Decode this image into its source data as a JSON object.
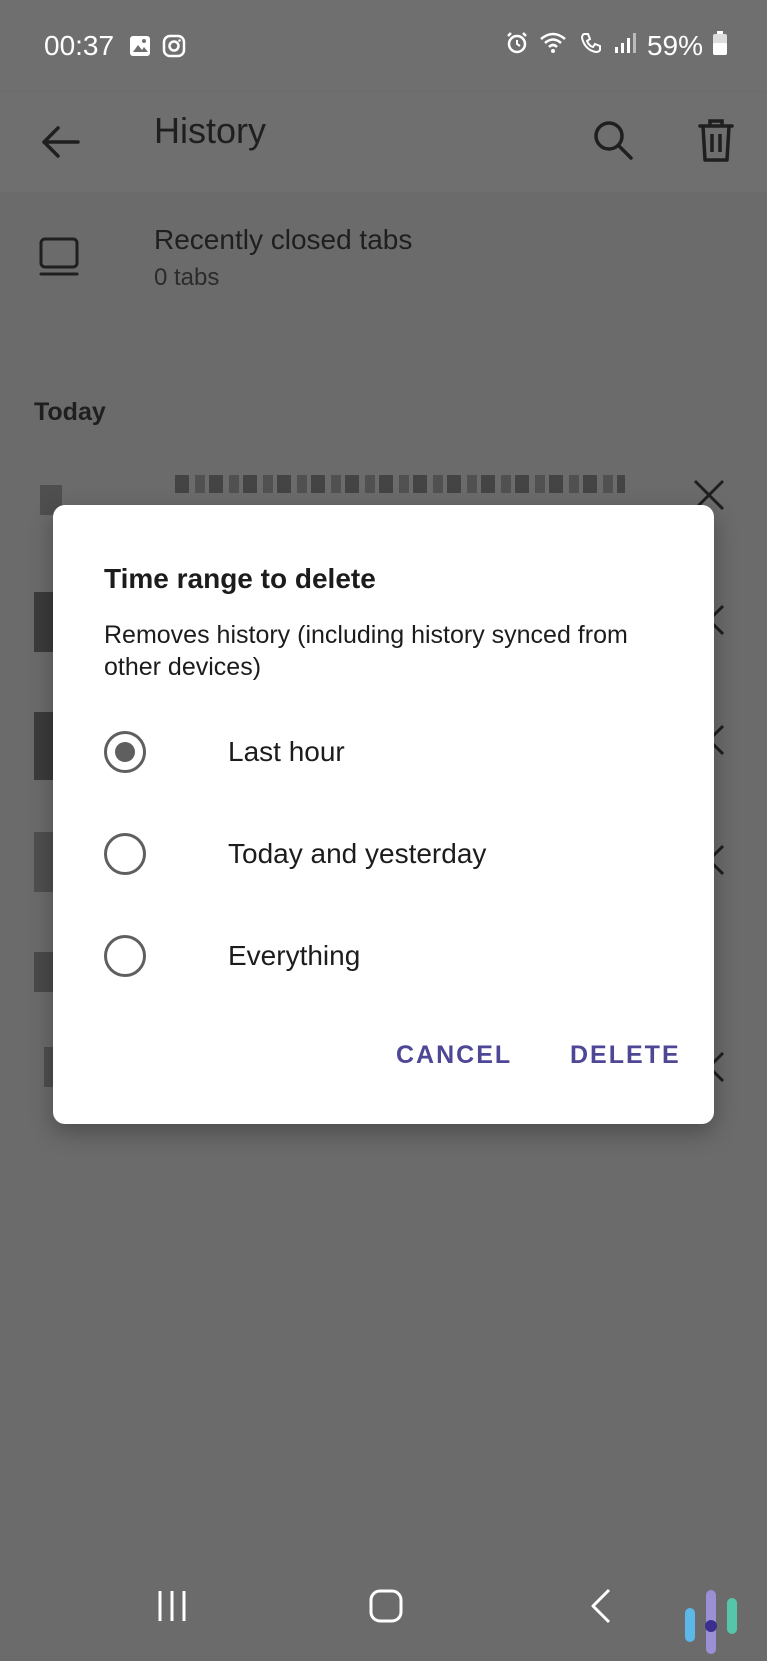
{
  "status_bar": {
    "time": "00:37",
    "battery": "59%",
    "icons": [
      "image-icon",
      "instagram-icon",
      "alarm-icon",
      "wifi-call-icon",
      "call-icon",
      "signal-icon",
      "battery-icon"
    ]
  },
  "app_bar": {
    "title": "History",
    "back_icon": "back-arrow-icon",
    "search_icon": "search-icon",
    "delete_icon": "trash-icon"
  },
  "recently_closed": {
    "title": "Recently closed tabs",
    "subtitle": "0 tabs",
    "icon": "tabs-icon"
  },
  "sections": [
    {
      "label": "Today"
    }
  ],
  "dialog": {
    "title": "Time range to delete",
    "description": "Removes history (including history synced from other devices)",
    "options": [
      {
        "label": "Last hour",
        "selected": true
      },
      {
        "label": "Today and yesterday",
        "selected": false
      },
      {
        "label": "Everything",
        "selected": false
      }
    ],
    "cancel_label": "CANCEL",
    "delete_label": "DELETE"
  },
  "colors": {
    "accent": "#4d4795",
    "scrim": "#6b6b6b",
    "radio": "#5f5f5f"
  }
}
